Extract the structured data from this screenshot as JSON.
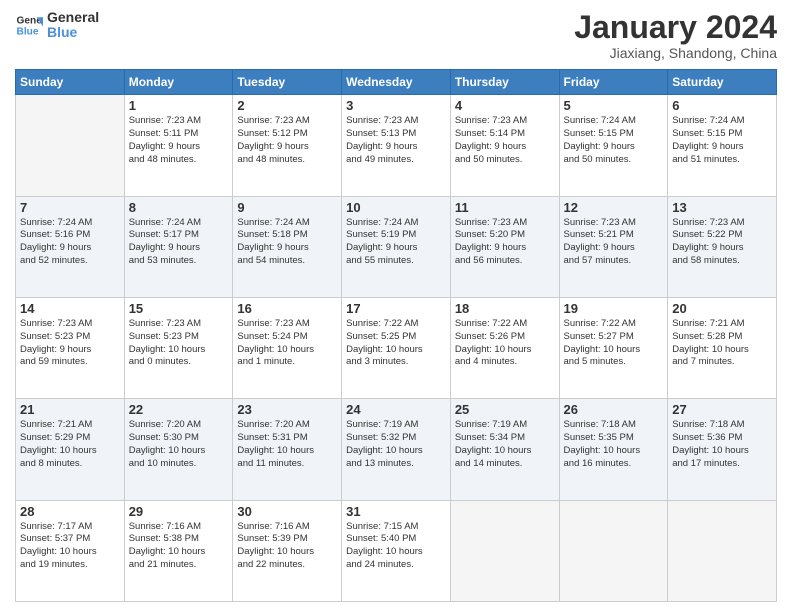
{
  "header": {
    "logo_line1": "General",
    "logo_line2": "Blue",
    "month": "January 2024",
    "location": "Jiaxiang, Shandong, China"
  },
  "days_of_week": [
    "Sunday",
    "Monday",
    "Tuesday",
    "Wednesday",
    "Thursday",
    "Friday",
    "Saturday"
  ],
  "weeks": [
    {
      "days": [
        {
          "number": "",
          "info": ""
        },
        {
          "number": "1",
          "info": "Sunrise: 7:23 AM\nSunset: 5:11 PM\nDaylight: 9 hours\nand 48 minutes."
        },
        {
          "number": "2",
          "info": "Sunrise: 7:23 AM\nSunset: 5:12 PM\nDaylight: 9 hours\nand 48 minutes."
        },
        {
          "number": "3",
          "info": "Sunrise: 7:23 AM\nSunset: 5:13 PM\nDaylight: 9 hours\nand 49 minutes."
        },
        {
          "number": "4",
          "info": "Sunrise: 7:23 AM\nSunset: 5:14 PM\nDaylight: 9 hours\nand 50 minutes."
        },
        {
          "number": "5",
          "info": "Sunrise: 7:24 AM\nSunset: 5:15 PM\nDaylight: 9 hours\nand 50 minutes."
        },
        {
          "number": "6",
          "info": "Sunrise: 7:24 AM\nSunset: 5:15 PM\nDaylight: 9 hours\nand 51 minutes."
        }
      ]
    },
    {
      "days": [
        {
          "number": "7",
          "info": "Sunrise: 7:24 AM\nSunset: 5:16 PM\nDaylight: 9 hours\nand 52 minutes."
        },
        {
          "number": "8",
          "info": "Sunrise: 7:24 AM\nSunset: 5:17 PM\nDaylight: 9 hours\nand 53 minutes."
        },
        {
          "number": "9",
          "info": "Sunrise: 7:24 AM\nSunset: 5:18 PM\nDaylight: 9 hours\nand 54 minutes."
        },
        {
          "number": "10",
          "info": "Sunrise: 7:24 AM\nSunset: 5:19 PM\nDaylight: 9 hours\nand 55 minutes."
        },
        {
          "number": "11",
          "info": "Sunrise: 7:23 AM\nSunset: 5:20 PM\nDaylight: 9 hours\nand 56 minutes."
        },
        {
          "number": "12",
          "info": "Sunrise: 7:23 AM\nSunset: 5:21 PM\nDaylight: 9 hours\nand 57 minutes."
        },
        {
          "number": "13",
          "info": "Sunrise: 7:23 AM\nSunset: 5:22 PM\nDaylight: 9 hours\nand 58 minutes."
        }
      ]
    },
    {
      "days": [
        {
          "number": "14",
          "info": "Sunrise: 7:23 AM\nSunset: 5:23 PM\nDaylight: 9 hours\nand 59 minutes."
        },
        {
          "number": "15",
          "info": "Sunrise: 7:23 AM\nSunset: 5:23 PM\nDaylight: 10 hours\nand 0 minutes."
        },
        {
          "number": "16",
          "info": "Sunrise: 7:23 AM\nSunset: 5:24 PM\nDaylight: 10 hours\nand 1 minute."
        },
        {
          "number": "17",
          "info": "Sunrise: 7:22 AM\nSunset: 5:25 PM\nDaylight: 10 hours\nand 3 minutes."
        },
        {
          "number": "18",
          "info": "Sunrise: 7:22 AM\nSunset: 5:26 PM\nDaylight: 10 hours\nand 4 minutes."
        },
        {
          "number": "19",
          "info": "Sunrise: 7:22 AM\nSunset: 5:27 PM\nDaylight: 10 hours\nand 5 minutes."
        },
        {
          "number": "20",
          "info": "Sunrise: 7:21 AM\nSunset: 5:28 PM\nDaylight: 10 hours\nand 7 minutes."
        }
      ]
    },
    {
      "days": [
        {
          "number": "21",
          "info": "Sunrise: 7:21 AM\nSunset: 5:29 PM\nDaylight: 10 hours\nand 8 minutes."
        },
        {
          "number": "22",
          "info": "Sunrise: 7:20 AM\nSunset: 5:30 PM\nDaylight: 10 hours\nand 10 minutes."
        },
        {
          "number": "23",
          "info": "Sunrise: 7:20 AM\nSunset: 5:31 PM\nDaylight: 10 hours\nand 11 minutes."
        },
        {
          "number": "24",
          "info": "Sunrise: 7:19 AM\nSunset: 5:32 PM\nDaylight: 10 hours\nand 13 minutes."
        },
        {
          "number": "25",
          "info": "Sunrise: 7:19 AM\nSunset: 5:34 PM\nDaylight: 10 hours\nand 14 minutes."
        },
        {
          "number": "26",
          "info": "Sunrise: 7:18 AM\nSunset: 5:35 PM\nDaylight: 10 hours\nand 16 minutes."
        },
        {
          "number": "27",
          "info": "Sunrise: 7:18 AM\nSunset: 5:36 PM\nDaylight: 10 hours\nand 17 minutes."
        }
      ]
    },
    {
      "days": [
        {
          "number": "28",
          "info": "Sunrise: 7:17 AM\nSunset: 5:37 PM\nDaylight: 10 hours\nand 19 minutes."
        },
        {
          "number": "29",
          "info": "Sunrise: 7:16 AM\nSunset: 5:38 PM\nDaylight: 10 hours\nand 21 minutes."
        },
        {
          "number": "30",
          "info": "Sunrise: 7:16 AM\nSunset: 5:39 PM\nDaylight: 10 hours\nand 22 minutes."
        },
        {
          "number": "31",
          "info": "Sunrise: 7:15 AM\nSunset: 5:40 PM\nDaylight: 10 hours\nand 24 minutes."
        },
        {
          "number": "",
          "info": ""
        },
        {
          "number": "",
          "info": ""
        },
        {
          "number": "",
          "info": ""
        }
      ]
    }
  ]
}
